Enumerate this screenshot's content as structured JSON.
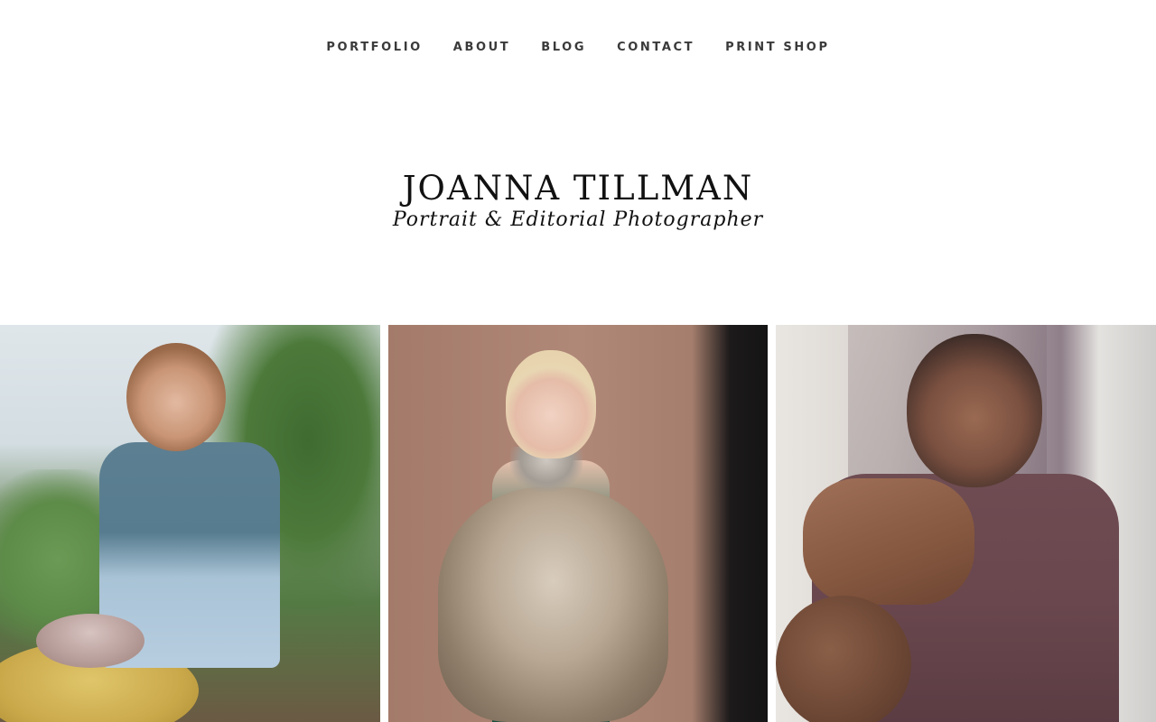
{
  "nav": {
    "items": [
      {
        "label": "PORTFOLIO"
      },
      {
        "label": "ABOUT"
      },
      {
        "label": "BLOG"
      },
      {
        "label": "CONTACT"
      },
      {
        "label": "PRINT SHOP"
      }
    ]
  },
  "logo": {
    "title": "JOANNA TILLMAN",
    "subtitle": "Portrait & Editorial Photographer"
  },
  "gallery": {
    "photos": [
      {
        "description_icon": "photo-pottery"
      },
      {
        "description_icon": "photo-fur-portrait"
      },
      {
        "description_icon": "photo-man-glasses"
      }
    ]
  },
  "colors": {
    "background": "#ffffff",
    "nav_text": "#3a3a3a",
    "logo_text": "#111111"
  }
}
